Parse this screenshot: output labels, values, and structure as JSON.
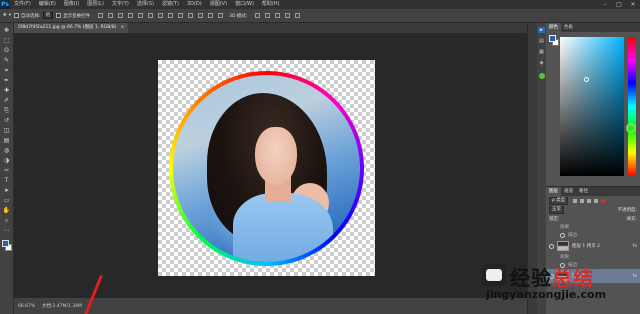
{
  "app": {
    "logo": "Ps"
  },
  "menubar": {
    "items": [
      "文件(F)",
      "编辑(E)",
      "图像(I)",
      "图层(L)",
      "文字(Y)",
      "选择(S)",
      "滤镜(T)",
      "3D(D)",
      "视图(V)",
      "窗口(W)",
      "帮助(H)"
    ],
    "window_controls": [
      "–",
      "□",
      "✕"
    ]
  },
  "options_bar": {
    "auto_select_label": "自动选择:",
    "auto_select_value": "组",
    "show_transform_label": "显示变换控件",
    "mode_label": "3D 模式:"
  },
  "document_tab": {
    "title": "5f8d7f4f2a211.jpg @ 66.7% (图层 1, RGB/8)",
    "close": "×"
  },
  "toolbar": {
    "tools": [
      "move-tool-icon",
      "marquee-tool-icon",
      "lasso-tool-icon",
      "quick-select-tool-icon",
      "crop-tool-icon",
      "eyedropper-tool-icon",
      "healing-brush-tool-icon",
      "brush-tool-icon",
      "clone-stamp-tool-icon",
      "history-brush-tool-icon",
      "eraser-tool-icon",
      "gradient-tool-icon",
      "blur-tool-icon",
      "dodge-tool-icon",
      "pen-tool-icon",
      "type-tool-icon",
      "path-select-tool-icon",
      "shape-tool-icon",
      "hand-tool-icon",
      "zoom-tool-icon",
      "more-tools-icon"
    ],
    "glyphs": [
      "✥",
      "⬚",
      "ʘ",
      "✎",
      "⌗",
      "✒",
      "✚",
      "✐",
      "⎘",
      "↺",
      "◫",
      "▤",
      "◍",
      "◑",
      "✑",
      "T",
      "➤",
      "▭",
      "✋",
      "⌕",
      "⋯"
    ],
    "foreground_color": "#2a5fae",
    "background_color": "#ffffff"
  },
  "status": {
    "zoom": "66.67%",
    "doc_info": "文档:2.47M/1.34M"
  },
  "right_strip": {
    "icons": [
      "▸",
      "▤",
      "▦",
      "◈"
    ]
  },
  "color_panel": {
    "tabs": [
      "颜色",
      "色板"
    ],
    "foreground_color": "#2a5fae",
    "background_color": "#ffffff"
  },
  "layers_panel": {
    "tabs": [
      "图层",
      "通道",
      "路径"
    ],
    "kind_label": "ρ 类型",
    "blend_mode": "正常",
    "opacity_label": "不透明度:",
    "lock_label": "锁定:",
    "fill_label": "填充:",
    "layers": [
      {
        "name": "效果",
        "sub": true
      },
      {
        "name": "描边",
        "sub": true
      },
      {
        "name": "图层 1 拷贝 2",
        "fx": "fx",
        "thumb": "photo"
      },
      {
        "name": "效果",
        "sub": true
      },
      {
        "name": "描边",
        "sub": true
      },
      {
        "name": "图层 1",
        "fx": "fx",
        "thumb": "photo",
        "selected": true
      }
    ]
  },
  "watermark": {
    "title_black": "经验",
    "title_red": "总结",
    "url": "jingyanzongjie.com"
  }
}
